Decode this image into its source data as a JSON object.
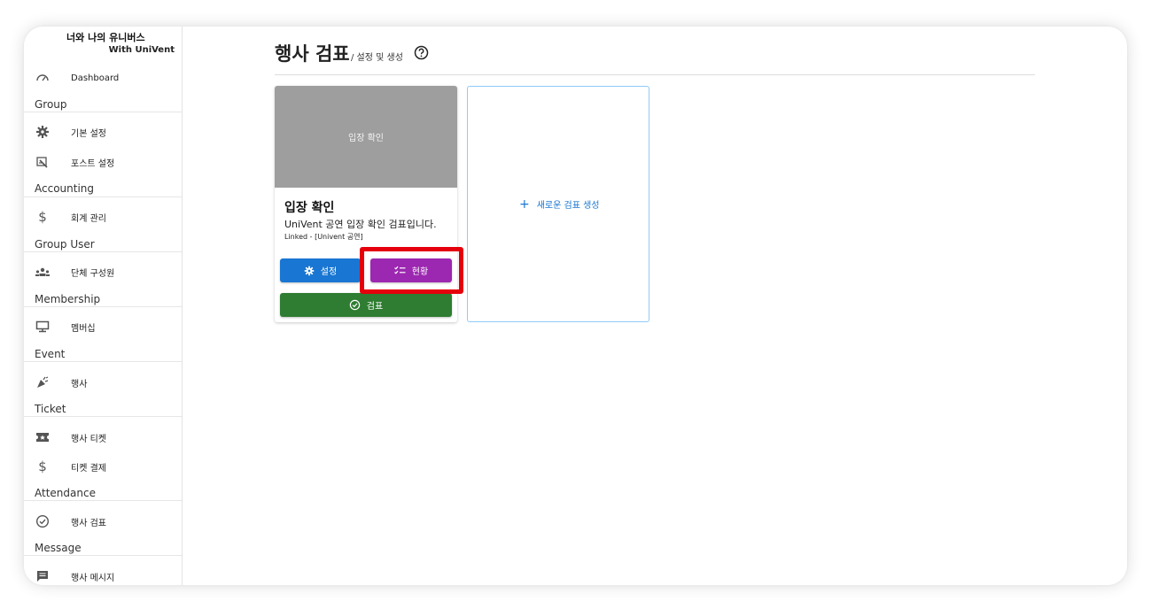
{
  "brand": {
    "title": "너와 나의 유니버스",
    "subtitle": "With UniVent"
  },
  "sidebar": {
    "dashboard": {
      "label": "Dashboard",
      "icon": "speedometer-icon"
    },
    "sections": [
      {
        "title": "Group",
        "items": [
          {
            "label": "기본 설정",
            "icon": "gear-icon"
          },
          {
            "label": "포스트 설정",
            "icon": "post-edit-icon"
          }
        ]
      },
      {
        "title": "Accounting",
        "items": [
          {
            "label": "회계 관리",
            "icon": "dollar-icon"
          }
        ]
      },
      {
        "title": "Group User",
        "items": [
          {
            "label": "단체 구성원",
            "icon": "group-icon"
          }
        ]
      },
      {
        "title": "Membership",
        "items": [
          {
            "label": "멤버십",
            "icon": "card-icon"
          }
        ]
      },
      {
        "title": "Event",
        "items": [
          {
            "label": "행사",
            "icon": "party-icon"
          }
        ]
      },
      {
        "title": "Ticket",
        "items": [
          {
            "label": "행사 티켓",
            "icon": "ticket-icon"
          },
          {
            "label": "티켓 결제",
            "icon": "dollar-icon"
          }
        ]
      },
      {
        "title": "Attendance",
        "items": [
          {
            "label": "행사 검표",
            "icon": "check-circle-icon"
          }
        ]
      },
      {
        "title": "Message",
        "items": [
          {
            "label": "행사 메시지",
            "icon": "message-icon"
          }
        ]
      }
    ]
  },
  "page": {
    "title": "행사 검표",
    "breadcrumb": "/ 설정 및 생성",
    "help_icon": "help-circle-icon"
  },
  "event_card": {
    "image_text": "입장 확인",
    "title": "입장 확인",
    "description": "UniVent 공연 입장 확인 검표입니다.",
    "linked": "Linked - [Univent 공연]",
    "buttons": {
      "settings": "설정",
      "status": "현황",
      "check": "검표"
    }
  },
  "new_card": {
    "label": "새로운 검표 생성"
  },
  "colors": {
    "settings_button": "#1976d2",
    "status_button": "#9c27b0",
    "check_button": "#2e7d32",
    "highlight": "#e5000b",
    "new_card_border": "#90caf9"
  }
}
